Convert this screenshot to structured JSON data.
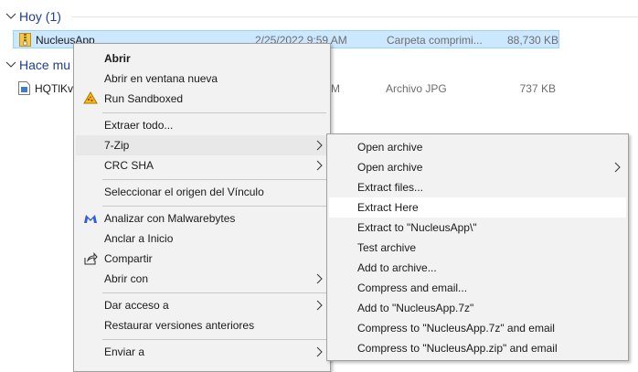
{
  "groups": [
    {
      "label": "Hoy (1)"
    },
    {
      "label": "Hace mu"
    }
  ],
  "files": [
    {
      "name": "NucleusApp",
      "date": "2/25/2022 9:59 AM",
      "type": "Carpeta comprimi...",
      "size": "88,730 KB"
    },
    {
      "name": "HQTlKv",
      "date": "AM",
      "type": "Archivo JPG",
      "size": "737 KB"
    }
  ],
  "context_menu": {
    "open": "Abrir",
    "open_new_window": "Abrir en ventana nueva",
    "run_sandboxed": "Run Sandboxed",
    "extract_all": "Extraer todo...",
    "seven_zip": "7-Zip",
    "crc_sha": "CRC SHA",
    "select_link_origin": "Seleccionar el origen del Vínculo",
    "malwarebytes": "Analizar con Malwarebytes",
    "pin_start": "Anclar a Inicio",
    "share": "Compartir",
    "open_with": "Abrir con",
    "give_access": "Dar acceso a",
    "restore_versions": "Restaurar versiones anteriores",
    "send_to": "Enviar a"
  },
  "submenu": {
    "open_archive": "Open archive",
    "open_archive_2": "Open archive",
    "extract_files": "Extract files...",
    "extract_here": "Extract Here",
    "extract_to": "Extract to \"NucleusApp\\\"",
    "test_archive": "Test archive",
    "add_to_archive": "Add to archive...",
    "compress_email": "Compress and email...",
    "add_to_7z": "Add to \"NucleusApp.7z\"",
    "compress_7z_email": "Compress to \"NucleusApp.7z\" and email",
    "compress_zip_email": "Compress to \"NucleusApp.zip\" and email"
  },
  "colors": {
    "selection": "#cce8ff",
    "header_text": "#1e3f8c",
    "menu_bg": "#f2f2f2",
    "malwarebytes": "#2f60d8"
  }
}
